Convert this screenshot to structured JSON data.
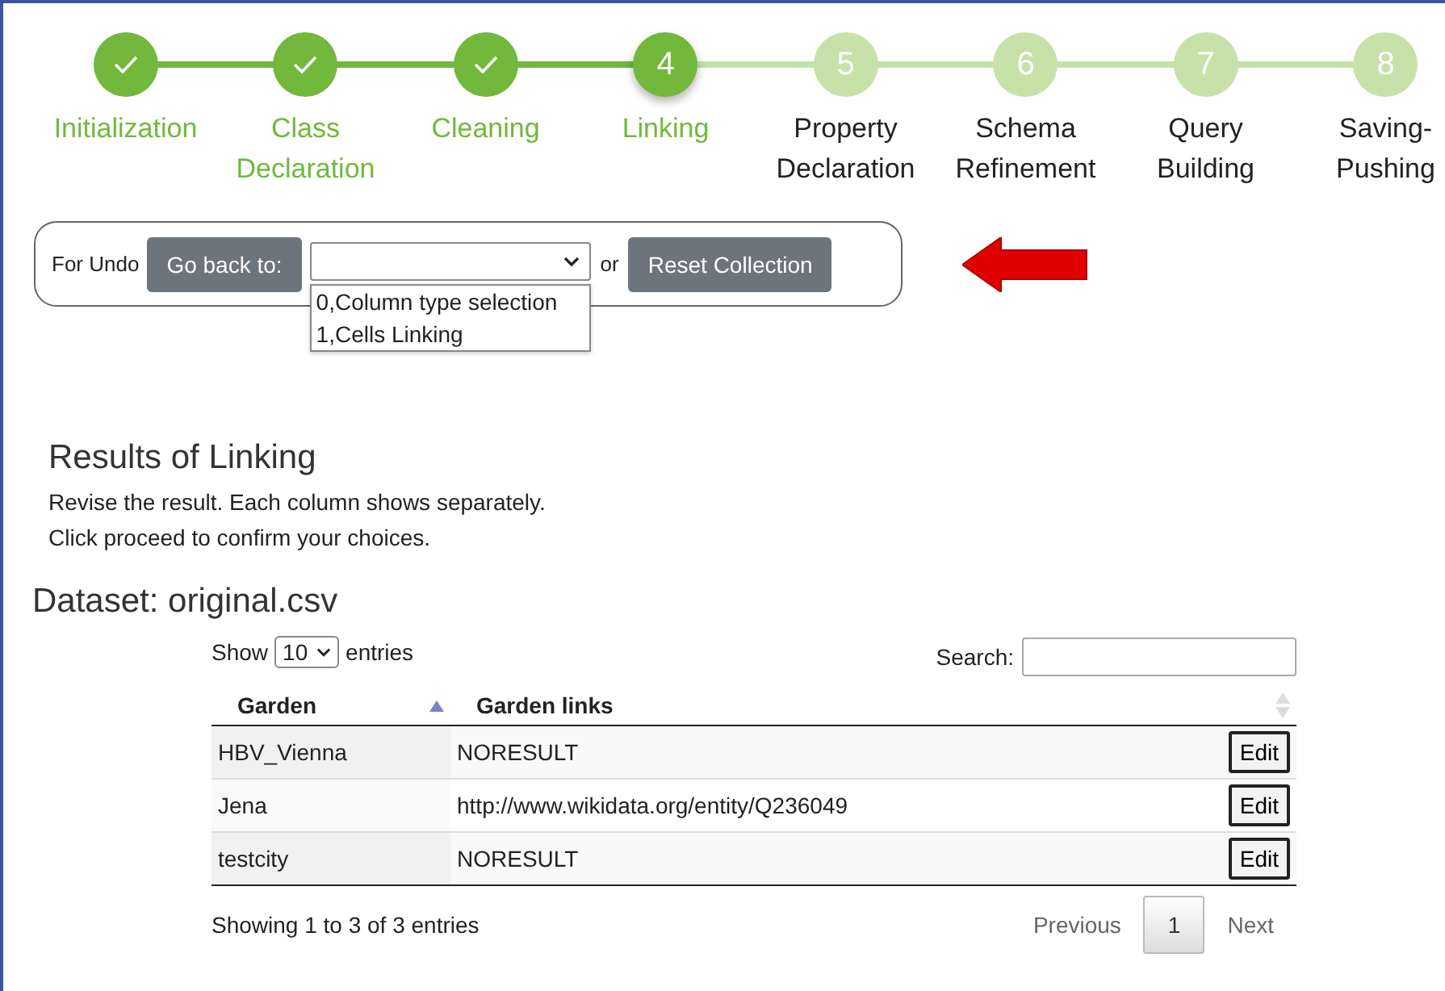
{
  "steps": [
    {
      "label": "Initialization",
      "completed": true,
      "selected": false
    },
    {
      "label": "Class Declaration",
      "completed": true,
      "selected": false
    },
    {
      "label": "Cleaning",
      "completed": true,
      "selected": false
    },
    {
      "label": "Linking",
      "completed": false,
      "selected": true,
      "number": "4"
    },
    {
      "label": "Property Declaration",
      "completed": false,
      "selected": false,
      "number": "5"
    },
    {
      "label": "Schema Refinement",
      "completed": false,
      "selected": false,
      "number": "6"
    },
    {
      "label": "Query Building",
      "completed": false,
      "selected": false,
      "number": "7"
    },
    {
      "label": "Saving-Pushing",
      "completed": false,
      "selected": false,
      "number": "8"
    }
  ],
  "undo": {
    "label": "For Undo",
    "back_button": "Go back to:",
    "or_text": "or",
    "reset_button": "Reset Collection",
    "dropdown_options": [
      "0,Column type selection",
      "1,Cells Linking"
    ]
  },
  "results": {
    "title": "Results of Linking",
    "lines": [
      "Revise the result. Each column shows separately.",
      "Click proceed to confirm your choices."
    ]
  },
  "dataset": {
    "title": "Dataset: original.csv",
    "length": {
      "show": "Show",
      "value": "10",
      "entries": "entries"
    },
    "search_label": "Search:",
    "columns": [
      {
        "label": "Garden",
        "sorted": true
      },
      {
        "label": "Garden links",
        "sorted": false
      }
    ],
    "rows": [
      {
        "garden": "HBV_Vienna",
        "link": "NORESULT",
        "action": "Edit"
      },
      {
        "garden": "Jena",
        "link": "http://www.wikidata.org/entity/Q236049",
        "action": "Edit"
      },
      {
        "garden": "testcity",
        "link": "NORESULT",
        "action": "Edit"
      }
    ],
    "info": "Showing 1 to 3 of 3 entries",
    "pagination": [
      {
        "label": "Previous",
        "kind": "nav"
      },
      {
        "label": "1",
        "kind": "page",
        "selected": true
      },
      {
        "label": "Next",
        "kind": "nav"
      }
    ]
  }
}
